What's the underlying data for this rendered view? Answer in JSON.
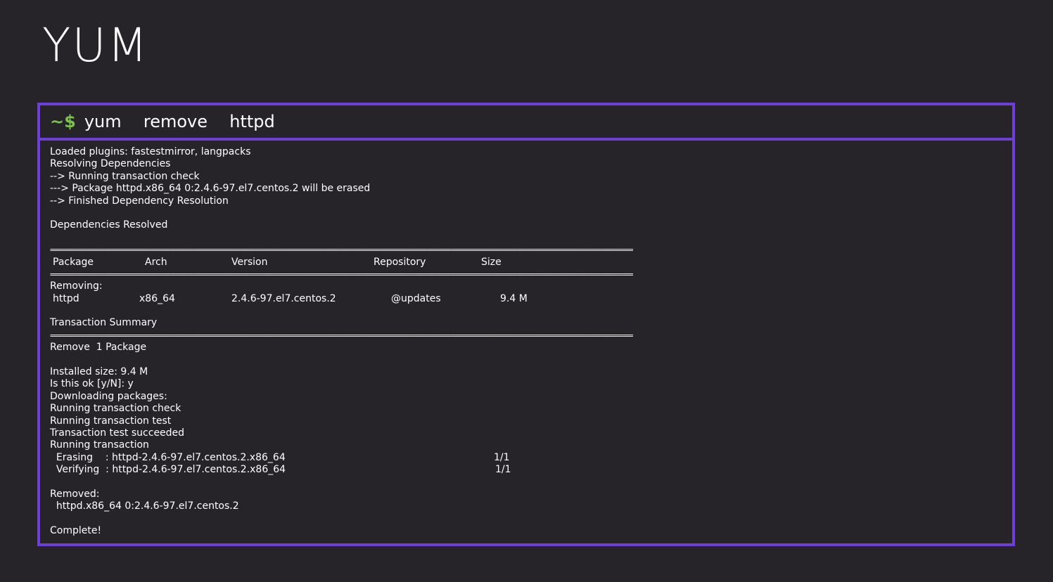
{
  "title": "YUM",
  "command": {
    "prompt": "~$",
    "text": "yum  remove  httpd"
  },
  "output": {
    "header_lines": [
      "Loaded plugins: fastestmirror, langpacks",
      "Resolving Dependencies",
      "--> Running transaction check",
      "---> Package httpd.x86_64 0:2.4.6-97.el7.centos.2 will be erased",
      "--> Finished Dependency Resolution"
    ],
    "deps_resolved": "Dependencies Resolved",
    "separator": "======================================================================================================================================================",
    "table": {
      "columns": [
        "Package",
        "Arch",
        "Version",
        "Repository",
        "Size"
      ],
      "section_label": "Removing:",
      "rows": [
        [
          "httpd",
          "x86_64",
          "2.4.6-97.el7.centos.2",
          "@updates",
          "9.4 M"
        ]
      ]
    },
    "transaction_summary": "Transaction Summary",
    "remove_line": "Remove  1 Package",
    "post_lines": [
      "Installed size: 9.4 M",
      "Is this ok [y/N]: y",
      "Downloading packages:",
      "Running transaction check",
      "Running transaction test",
      "Transaction test succeeded",
      "Running transaction"
    ],
    "steps": [
      {
        "action": "  Erasing    : httpd-2.4.6-97.el7.centos.2.x86_64",
        "progress": "1/1"
      },
      {
        "action": "  Verifying  : httpd-2.4.6-97.el7.centos.2.x86_64",
        "progress": "1/1"
      }
    ],
    "removed_label": "Removed:",
    "removed_item": "  httpd.x86_64 0:2.4.6-97.el7.centos.2",
    "complete": "Complete!"
  }
}
